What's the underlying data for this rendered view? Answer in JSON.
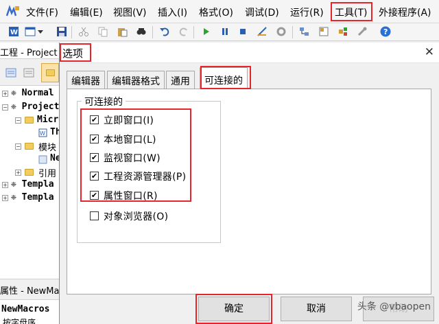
{
  "menubar": {
    "items": [
      "文件(F)",
      "编辑(E)",
      "视图(V)",
      "插入(I)",
      "格式(O)",
      "调试(D)",
      "运行(R)",
      "工具(T)",
      "外接程序(A)"
    ]
  },
  "project": {
    "title": "工程 - Project",
    "tree": {
      "normal": "Normal",
      "project": "Project",
      "microsoft": "Micr",
      "thisdoc": "Th",
      "modules": "模块",
      "newmacros": "Ne",
      "refs": "引用",
      "template1": "Templa",
      "template2": "Templa"
    }
  },
  "properties": {
    "title": "属性 - NewMac",
    "object": "NewMacros",
    "tab": "按字母序"
  },
  "dialog": {
    "title": "选项",
    "close": "✕",
    "tabs": [
      "编辑器",
      "编辑器格式",
      "通用",
      "可连接的"
    ],
    "group_label": "可连接的",
    "options": [
      {
        "label": "立即窗口(I)",
        "checked": "✔"
      },
      {
        "label": "本地窗口(L)",
        "checked": "✔"
      },
      {
        "label": "监视窗口(W)",
        "checked": "✔"
      },
      {
        "label": "工程资源管理器(P)",
        "checked": "✔"
      },
      {
        "label": "属性窗口(R)",
        "checked": "✔"
      },
      {
        "label": "对象浏览器(O)",
        "checked": ""
      }
    ],
    "ok": "确定",
    "cancel": "取消",
    "help": "帮助"
  },
  "watermark": "头条 @vbaopen",
  "colors": {
    "highlight": "#e8232a",
    "toolbar_play": "#2aa52a",
    "help_blue": "#2a6fd6"
  }
}
